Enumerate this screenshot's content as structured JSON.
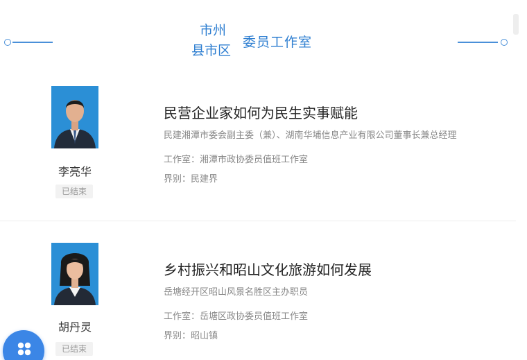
{
  "header": {
    "tab_city": "市州",
    "tab_county": "县市区",
    "title": "委员工作室"
  },
  "accent_color": "#2f7fd1",
  "cards": [
    {
      "name": "李亮华",
      "status": "已结束",
      "topic": "民营企业家如何为民生实事赋能",
      "position": "民建湘潭市委会副主委（兼）、湖南华埔信息产业有限公司董事长兼总经理",
      "office_label": "工作室：",
      "office": "湘潭市政协委员值班工作室",
      "sector_label": "界别：",
      "sector": "民建界"
    },
    {
      "name": "胡丹灵",
      "status": "已结束",
      "topic": "乡村振兴和昭山文化旅游如何发展",
      "position": "岳塘经开区昭山风景名胜区主办职员",
      "office_label": "工作室：",
      "office": "岳塘区政协委员值班工作室",
      "sector_label": "界别：",
      "sector": "昭山镇"
    }
  ],
  "fab_icon": "apps-icon"
}
